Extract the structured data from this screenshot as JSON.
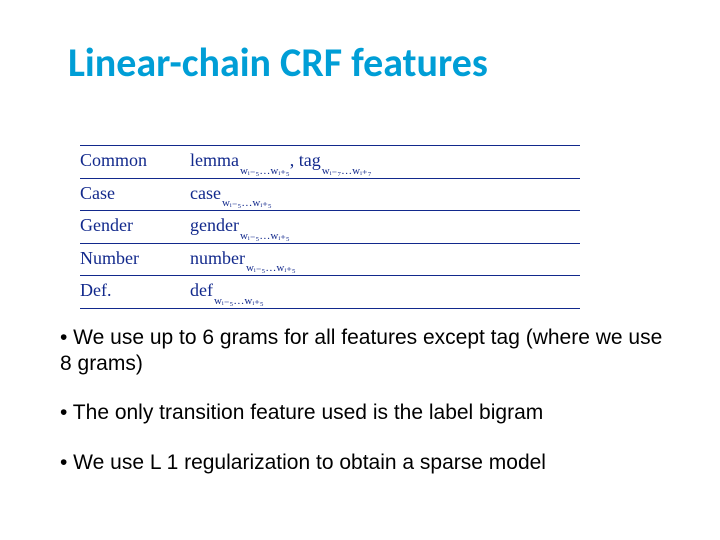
{
  "title": "Linear-chain CRF features",
  "table": {
    "rows": [
      {
        "label": "Common",
        "feat1": "lemma",
        "range1": "wᵢ₋₅…wᵢ₊₅",
        "feat2": "tag",
        "range2": "wᵢ₋₇…wᵢ₊₇"
      },
      {
        "label": "Case",
        "feat1": "case",
        "range1": "wᵢ₋₅…wᵢ₊₅"
      },
      {
        "label": "Gender",
        "feat1": "gender",
        "range1": "wᵢ₋₅…wᵢ₊₅"
      },
      {
        "label": "Number",
        "feat1": "number",
        "range1": "wᵢ₋₅…wᵢ₊₅"
      },
      {
        "label": "Def.",
        "feat1": "def",
        "range1": "wᵢ₋₅…wᵢ₊₅"
      }
    ]
  },
  "bullets": {
    "b1": "• We use up to 6 grams for all features except tag (where we use 8 grams)",
    "b2": "• The only transition feature used is the label bigram",
    "b3": "• We use L 1 regularization to obtain a sparse model"
  }
}
